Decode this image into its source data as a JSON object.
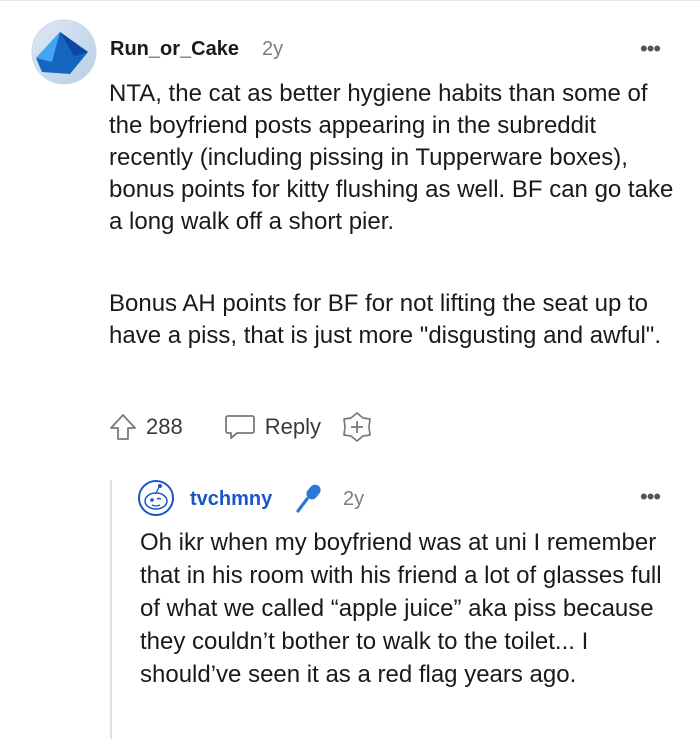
{
  "comment": {
    "author": "Run_or_Cake",
    "time": "2y",
    "more": "•••",
    "paragraphs": [
      "NTA, the cat as better hygiene habits than some of the boyfriend posts appearing in the subreddit recently (including pissing in Tupperware boxes), bonus points for kitty flushing as well. BF can go take a long walk off a short pier.",
      "Bonus AH points for BF for not lifting the seat up to have a piss, that is just more \"disgusting and awful\"."
    ],
    "votes": "288",
    "reply_label": "Reply",
    "icons": {
      "upvote": "upvote-arrow-icon",
      "reply": "speech-bubble-icon",
      "award": "award-plus-icon",
      "more": "more-options-icon"
    }
  },
  "reply": {
    "author": "tvchmny",
    "time": "2y",
    "more": "•••",
    "text": "Oh ikr when my boyfriend was at uni I remember that in his room with his friend a lot of glasses full of what we called “apple juice” aka piss because they couldn’t bother to walk to the toilet... I should’ve seen it as a red flag years ago.",
    "icons": {
      "avatar": "snoo-avatar",
      "flair": "microphone-icon"
    }
  },
  "colors": {
    "reply_author": "#1b56c8",
    "muted": "#7c7c7c",
    "text": "#1a1a1b",
    "avatar_blue": "#1565c0"
  }
}
